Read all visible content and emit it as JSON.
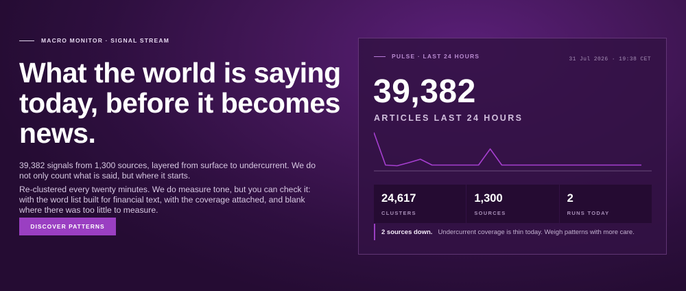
{
  "hero": {
    "eyebrow": "MACRO MONITOR · SIGNAL STREAM",
    "headline": "What the world is saying today, before it becomes news.",
    "paragraph1": "39,382 signals from 1,300 sources, layered from surface to undercurrent. We do not only count what is said, but where it starts.",
    "paragraph2": "Re-clustered every twenty minutes. We do measure tone, but you can check it: with the word list built for financial text, with the coverage attached, and blank where there was too little to measure.",
    "cta_label": "DISCOVER PATTERNS"
  },
  "pulse": {
    "eyebrow": "PULSE · LAST 24 HOURS",
    "timestamp": "31 Jul 2026 · 19:38 CET",
    "big_number": "39,382",
    "big_label": "ARTICLES LAST 24 HOURS",
    "sparkline": [
      100,
      5,
      3,
      12,
      22,
      5,
      5,
      5,
      5,
      5,
      52,
      5,
      5,
      5,
      5,
      5,
      5,
      5,
      5,
      5,
      5,
      5,
      5,
      5
    ],
    "stats": [
      {
        "value": "24,617",
        "label": "CLUSTERS"
      },
      {
        "value": "1,300",
        "label": "SOURCES"
      },
      {
        "value": "2",
        "label": "RUNS TODAY"
      }
    ],
    "alert_strong": "2 sources down.",
    "alert_text": "Undercurrent coverage is thin today. Weigh patterns with more care.",
    "accent_color": "#9a3fc2"
  }
}
